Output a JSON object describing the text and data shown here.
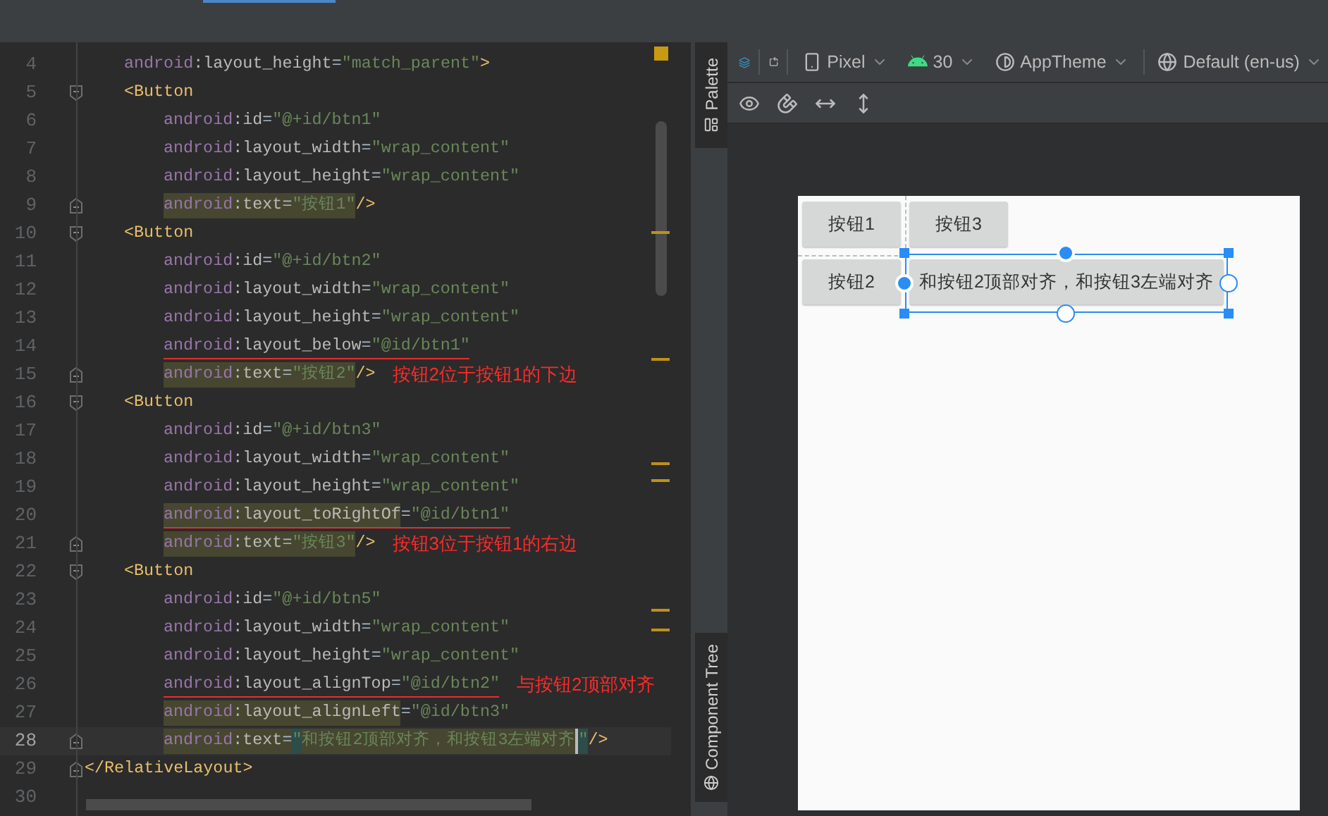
{
  "editor": {
    "lines": [
      {
        "kind": "attribute",
        "number": "4",
        "current": false,
        "underlined": false,
        "tokens": [
          {
            "text": "android",
            "kind": "namespace",
            "highlighted": false
          },
          {
            "text": ":layout_height",
            "kind": "attribute",
            "highlighted": false
          },
          {
            "text": "=",
            "kind": "operator",
            "highlighted": false
          },
          {
            "text": "\"match_parent\"",
            "kind": "value",
            "highlighted": false
          },
          {
            "text": ">",
            "kind": "tag",
            "highlighted": false
          }
        ]
      },
      {
        "kind": "element",
        "number": "5",
        "current": false,
        "underlined": false,
        "tokens": [
          {
            "text": "<Button",
            "kind": "tag",
            "highlighted": false
          }
        ],
        "children": [
          {
            "kind": "attribute",
            "number": "6",
            "current": false,
            "underlined": false,
            "tokens": [
              {
                "text": "android",
                "kind": "namespace",
                "highlighted": false
              },
              {
                "text": ":id",
                "kind": "attribute",
                "highlighted": false
              },
              {
                "text": "=",
                "kind": "operator",
                "highlighted": false
              },
              {
                "text": "\"@+id/btn1\"",
                "kind": "value",
                "highlighted": false
              }
            ]
          },
          {
            "kind": "attribute",
            "number": "7",
            "current": false,
            "underlined": false,
            "tokens": [
              {
                "text": "android",
                "kind": "namespace",
                "highlighted": false
              },
              {
                "text": ":layout_width",
                "kind": "attribute",
                "highlighted": false
              },
              {
                "text": "=",
                "kind": "operator",
                "highlighted": false
              },
              {
                "text": "\"wrap_content\"",
                "kind": "value",
                "highlighted": false
              }
            ]
          },
          {
            "kind": "attribute",
            "number": "8",
            "current": false,
            "underlined": false,
            "tokens": [
              {
                "text": "android",
                "kind": "namespace",
                "highlighted": false
              },
              {
                "text": ":layout_height",
                "kind": "attribute",
                "highlighted": false
              },
              {
                "text": "=",
                "kind": "operator",
                "highlighted": false
              },
              {
                "text": "\"wrap_content\"",
                "kind": "value",
                "highlighted": false
              }
            ]
          },
          {
            "kind": "attribute_end",
            "number": "9",
            "current": false,
            "underlined": false,
            "tokens": [
              {
                "text": "android",
                "kind": "namespace",
                "highlighted": true
              },
              {
                "text": ":text",
                "kind": "attribute",
                "highlighted": true
              },
              {
                "text": "=",
                "kind": "operator",
                "highlighted": true
              },
              {
                "text": "\"按钮1\"",
                "kind": "value",
                "highlighted": true
              },
              {
                "text": "/>",
                "kind": "tag",
                "highlighted": false
              }
            ]
          }
        ]
      },
      {
        "kind": "element",
        "number": "10",
        "current": false,
        "underlined": false,
        "tokens": [
          {
            "text": "<Button",
            "kind": "tag",
            "highlighted": false
          }
        ],
        "children": [
          {
            "kind": "attribute",
            "number": "11",
            "current": false,
            "underlined": false,
            "tokens": [
              {
                "text": "android",
                "kind": "namespace",
                "highlighted": false
              },
              {
                "text": ":id",
                "kind": "attribute",
                "highlighted": false
              },
              {
                "text": "=",
                "kind": "operator",
                "highlighted": false
              },
              {
                "text": "\"@+id/btn2\"",
                "kind": "value",
                "highlighted": false
              }
            ]
          },
          {
            "kind": "attribute",
            "number": "12",
            "current": false,
            "underlined": false,
            "tokens": [
              {
                "text": "android",
                "kind": "namespace",
                "highlighted": false
              },
              {
                "text": ":layout_width",
                "kind": "attribute",
                "highlighted": false
              },
              {
                "text": "=",
                "kind": "operator",
                "highlighted": false
              },
              {
                "text": "\"wrap_content\"",
                "kind": "value",
                "highlighted": false
              }
            ]
          },
          {
            "kind": "attribute",
            "number": "13",
            "current": false,
            "underlined": false,
            "tokens": [
              {
                "text": "android",
                "kind": "namespace",
                "highlighted": false
              },
              {
                "text": ":layout_height",
                "kind": "attribute",
                "highlighted": false
              },
              {
                "text": "=",
                "kind": "operator",
                "highlighted": false
              },
              {
                "text": "\"wrap_content\"",
                "kind": "value",
                "highlighted": false
              }
            ]
          },
          {
            "kind": "attribute",
            "number": "14",
            "current": false,
            "underlined": true,
            "tokens": [
              {
                "text": "android",
                "kind": "namespace",
                "highlighted": false
              },
              {
                "text": ":layout_below",
                "kind": "attribute",
                "highlighted": false
              },
              {
                "text": "=",
                "kind": "operator",
                "highlighted": false
              },
              {
                "text": "\"@id/btn1\"",
                "kind": "value",
                "highlighted": false
              }
            ]
          },
          {
            "kind": "attribute_end",
            "number": "15",
            "current": false,
            "underlined": false,
            "annotation": "按钮2位于按钮1的下边",
            "tokens": [
              {
                "text": "android",
                "kind": "namespace",
                "highlighted": true
              },
              {
                "text": ":text",
                "kind": "attribute",
                "highlighted": true
              },
              {
                "text": "=",
                "kind": "operator",
                "highlighted": true
              },
              {
                "text": "\"按钮2\"",
                "kind": "value",
                "highlighted": true
              },
              {
                "text": "/>",
                "kind": "tag",
                "highlighted": false
              }
            ]
          }
        ]
      },
      {
        "kind": "element",
        "number": "16",
        "current": false,
        "underlined": false,
        "tokens": [
          {
            "text": "<Button",
            "kind": "tag",
            "highlighted": false
          }
        ],
        "children": [
          {
            "kind": "attribute",
            "number": "17",
            "current": false,
            "underlined": false,
            "tokens": [
              {
                "text": "android",
                "kind": "namespace",
                "highlighted": false
              },
              {
                "text": ":id",
                "kind": "attribute",
                "highlighted": false
              },
              {
                "text": "=",
                "kind": "operator",
                "highlighted": false
              },
              {
                "text": "\"@+id/btn3\"",
                "kind": "value",
                "highlighted": false
              }
            ]
          },
          {
            "kind": "attribute",
            "number": "18",
            "current": false,
            "underlined": false,
            "tokens": [
              {
                "text": "android",
                "kind": "namespace",
                "highlighted": false
              },
              {
                "text": ":layout_width",
                "kind": "attribute",
                "highlighted": false
              },
              {
                "text": "=",
                "kind": "operator",
                "highlighted": false
              },
              {
                "text": "\"wrap_content\"",
                "kind": "value",
                "highlighted": false
              }
            ]
          },
          {
            "kind": "attribute",
            "number": "19",
            "current": false,
            "underlined": false,
            "tokens": [
              {
                "text": "android",
                "kind": "namespace",
                "highlighted": false
              },
              {
                "text": ":layout_height",
                "kind": "attribute",
                "highlighted": false
              },
              {
                "text": "=",
                "kind": "operator",
                "highlighted": false
              },
              {
                "text": "\"wrap_content\"",
                "kind": "value",
                "highlighted": false
              }
            ]
          },
          {
            "kind": "attribute",
            "number": "20",
            "current": false,
            "underlined": true,
            "tokens": [
              {
                "text": "android",
                "kind": "namespace",
                "highlighted": true
              },
              {
                "text": ":layout_toRightOf",
                "kind": "attribute",
                "highlighted": true
              },
              {
                "text": "=",
                "kind": "operator",
                "highlighted": false
              },
              {
                "text": "\"@id/btn1\"",
                "kind": "value",
                "highlighted": false
              }
            ]
          },
          {
            "kind": "attribute_end",
            "number": "21",
            "current": false,
            "underlined": false,
            "annotation": "按钮3位于按钮1的右边",
            "tokens": [
              {
                "text": "android",
                "kind": "namespace",
                "highlighted": true
              },
              {
                "text": ":text",
                "kind": "attribute",
                "highlighted": true
              },
              {
                "text": "=",
                "kind": "operator",
                "highlighted": true
              },
              {
                "text": "\"按钮3\"",
                "kind": "value",
                "highlighted": true
              },
              {
                "text": "/>",
                "kind": "tag",
                "highlighted": false
              }
            ]
          }
        ]
      },
      {
        "kind": "element",
        "number": "22",
        "current": false,
        "underlined": false,
        "tokens": [
          {
            "text": "<Button",
            "kind": "tag",
            "highlighted": false
          }
        ],
        "children": [
          {
            "kind": "attribute",
            "number": "23",
            "current": false,
            "underlined": false,
            "tokens": [
              {
                "text": "android",
                "kind": "namespace",
                "highlighted": false
              },
              {
                "text": ":id",
                "kind": "attribute",
                "highlighted": false
              },
              {
                "text": "=",
                "kind": "operator",
                "highlighted": false
              },
              {
                "text": "\"@+id/btn5\"",
                "kind": "value",
                "highlighted": false
              }
            ]
          },
          {
            "kind": "attribute",
            "number": "24",
            "current": false,
            "underlined": false,
            "tokens": [
              {
                "text": "android",
                "kind": "namespace",
                "highlighted": false
              },
              {
                "text": ":layout_width",
                "kind": "attribute",
                "highlighted": false
              },
              {
                "text": "=",
                "kind": "operator",
                "highlighted": false
              },
              {
                "text": "\"wrap_content\"",
                "kind": "value",
                "highlighted": false
              }
            ]
          },
          {
            "kind": "attribute",
            "number": "25",
            "current": false,
            "underlined": false,
            "tokens": [
              {
                "text": "android",
                "kind": "namespace",
                "highlighted": false
              },
              {
                "text": ":layout_height",
                "kind": "attribute",
                "highlighted": false
              },
              {
                "text": "=",
                "kind": "operator",
                "highlighted": false
              },
              {
                "text": "\"wrap_content\"",
                "kind": "value",
                "highlighted": false
              }
            ]
          },
          {
            "kind": "attribute",
            "number": "26",
            "current": false,
            "underlined": true,
            "annotation": "与按钮2顶部对齐",
            "tokens": [
              {
                "text": "android",
                "kind": "namespace",
                "highlighted": false
              },
              {
                "text": ":layout_alignTop",
                "kind": "attribute",
                "highlighted": false
              },
              {
                "text": "=",
                "kind": "operator",
                "highlighted": false
              },
              {
                "text": "\"@id/btn2\"",
                "kind": "value",
                "highlighted": false
              }
            ]
          },
          {
            "kind": "attribute",
            "number": "27",
            "current": false,
            "underlined": false,
            "tokens": [
              {
                "text": "android",
                "kind": "namespace",
                "highlighted": true
              },
              {
                "text": ":layout_alignLeft",
                "kind": "attribute",
                "highlighted": true
              },
              {
                "text": "=",
                "kind": "operator",
                "highlighted": false
              },
              {
                "text": "\"@id/btn3\"",
                "kind": "value",
                "highlighted": false
              }
            ]
          },
          {
            "kind": "attribute_end",
            "number": "28",
            "current": true,
            "underlined": false,
            "tokens": [
              {
                "text": "android",
                "kind": "namespace",
                "highlighted": true
              },
              {
                "text": ":text",
                "kind": "attribute",
                "highlighted": true
              },
              {
                "text": "=",
                "kind": "operator",
                "highlighted": true
              },
              {
                "text": "\"",
                "kind": "quote",
                "highlighted": false
              },
              {
                "text": "和按钮2顶部对齐，和按钮3左端对齐",
                "kind": "value",
                "highlighted": true
              },
              {
                "text": "\"",
                "kind": "quote",
                "highlighted": false,
                "caret": true
              },
              {
                "text": "/>",
                "kind": "tag",
                "highlighted": false
              }
            ]
          }
        ]
      },
      {
        "kind": "closing",
        "number": "29",
        "current": false,
        "underlined": false,
        "tokens": [
          {
            "text": "</RelativeLayout>",
            "kind": "tag",
            "highlighted": false
          }
        ]
      },
      {
        "kind": "empty",
        "number": "30",
        "current": false
      }
    ]
  },
  "side_tabs": [
    {
      "label": "Palette"
    },
    {
      "label": "Component Tree"
    }
  ],
  "toolbar": {
    "device": "Pixel",
    "api_level": "30",
    "theme": "AppTheme",
    "locale": "Default (en-us)"
  },
  "preview": {
    "buttons": [
      {
        "label": "按钮1",
        "selected": false
      },
      {
        "label": "按钮3",
        "selected": false
      },
      {
        "label": "按钮2",
        "selected": false
      },
      {
        "label": "和按钮2顶部对齐，和按钮3左端对齐",
        "selected": true
      }
    ]
  }
}
